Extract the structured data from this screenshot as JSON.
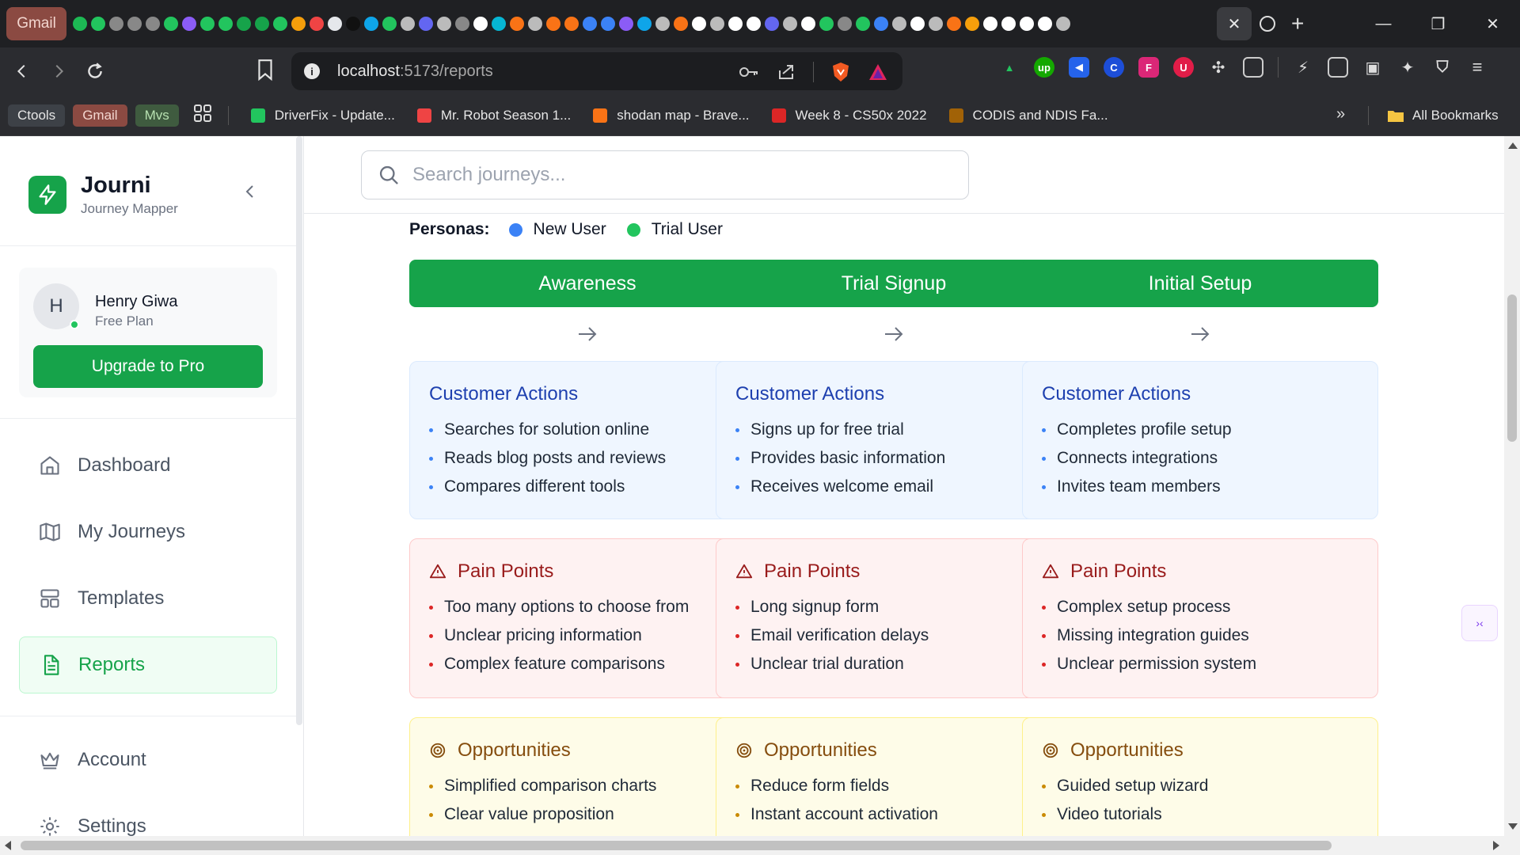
{
  "browser": {
    "first_tab_label": "Gmail",
    "pinned_favicons": [
      "#1db954",
      "#22c55e",
      "#888",
      "#888",
      "#888",
      "#22c55e",
      "#8b5cf6",
      "#22c55e",
      "#22c55e",
      "#16a34a",
      "#16a34a",
      "#22c55e",
      "#f59e0b",
      "#ef4444",
      "#e5e7eb",
      "#111",
      "#0ea5e9",
      "#22c55e",
      "#bbb",
      "#6366f1",
      "#bbb",
      "#888",
      "#fff",
      "#06b6d4",
      "#f97316",
      "#bbb",
      "#f97316",
      "#f97316",
      "#3b82f6",
      "#3b82f6",
      "#8b5cf6",
      "#0ea5e9",
      "#bbb",
      "#f97316",
      "#fff",
      "#bbb",
      "#fff",
      "#fff",
      "#6366f1",
      "#bbb",
      "#fff",
      "#22c55e",
      "#888",
      "#22c55e",
      "#3b82f6",
      "#bbb",
      "#fff",
      "#bbb",
      "#f97316",
      "#f59e0b",
      "#fff",
      "#fff",
      "#fff",
      "#fff",
      "#bbb"
    ],
    "url_host": "localhost",
    "url_path": ":5173/reports",
    "bookmarks": {
      "chips": [
        {
          "label": "Ctools",
          "bg": "#3d4147",
          "fg": "#e6e6e6"
        },
        {
          "label": "Gmail",
          "bg": "#8b4a42",
          "fg": "#f3d6cf"
        },
        {
          "label": "Mvs",
          "bg": "#3f5b3f",
          "fg": "#b7e0b0"
        }
      ],
      "items": [
        {
          "label": "DriverFix - Update...",
          "icon_color": "#22c55e"
        },
        {
          "label": "Mr. Robot Season 1...",
          "icon_color": "#ef4444"
        },
        {
          "label": "shodan map - Brave...",
          "icon_color": "#f97316"
        },
        {
          "label": "Week 8 - CS50x 2022",
          "icon_color": "#dc2626"
        },
        {
          "label": "CODIS and NDIS Fa...",
          "icon_color": "#a16207"
        }
      ],
      "all_bookmarks": "All Bookmarks"
    }
  },
  "app": {
    "name": "Journi",
    "tagline": "Journey Mapper",
    "user": {
      "initial": "H",
      "name": "Henry Giwa",
      "plan": "Free Plan",
      "upgrade_label": "Upgrade to Pro"
    },
    "nav": [
      {
        "label": "Dashboard",
        "icon": "home-icon"
      },
      {
        "label": "My Journeys",
        "icon": "map-icon"
      },
      {
        "label": "Templates",
        "icon": "layout-icon"
      },
      {
        "label": "Reports",
        "icon": "file-text-icon",
        "active": true
      },
      {
        "label": "Account",
        "icon": "crown-icon"
      },
      {
        "label": "Settings",
        "icon": "gear-icon"
      }
    ],
    "search_placeholder": "Search journeys..."
  },
  "journey": {
    "personas_label": "Personas:",
    "personas": [
      {
        "name": "New User",
        "color": "#3b82f6"
      },
      {
        "name": "Trial User",
        "color": "#22c55e"
      }
    ],
    "section_titles": {
      "actions": "Customer Actions",
      "pain": "Pain Points",
      "opps": "Opportunities"
    },
    "stages": [
      {
        "name": "Awareness",
        "actions": [
          "Searches for solution online",
          "Reads blog posts and reviews",
          "Compares different tools"
        ],
        "pain_points": [
          "Too many options to choose from",
          "Unclear pricing information",
          "Complex feature comparisons"
        ],
        "opportunities": [
          "Simplified comparison charts",
          "Clear value proposition"
        ]
      },
      {
        "name": "Trial Signup",
        "actions": [
          "Signs up for free trial",
          "Provides basic information",
          "Receives welcome email"
        ],
        "pain_points": [
          "Long signup form",
          "Email verification delays",
          "Unclear trial duration"
        ],
        "opportunities": [
          "Reduce form fields",
          "Instant account activation"
        ]
      },
      {
        "name": "Initial Setup",
        "actions": [
          "Completes profile setup",
          "Connects integrations",
          "Invites team members"
        ],
        "pain_points": [
          "Complex setup process",
          "Missing integration guides",
          "Unclear permission system"
        ],
        "opportunities": [
          "Guided setup wizard",
          "Video tutorials"
        ]
      }
    ]
  },
  "colors": {
    "brand_green": "#16a34a",
    "actions_bg": "#eff6ff",
    "pain_bg": "#fef2f2",
    "opps_bg": "#fefce8"
  }
}
